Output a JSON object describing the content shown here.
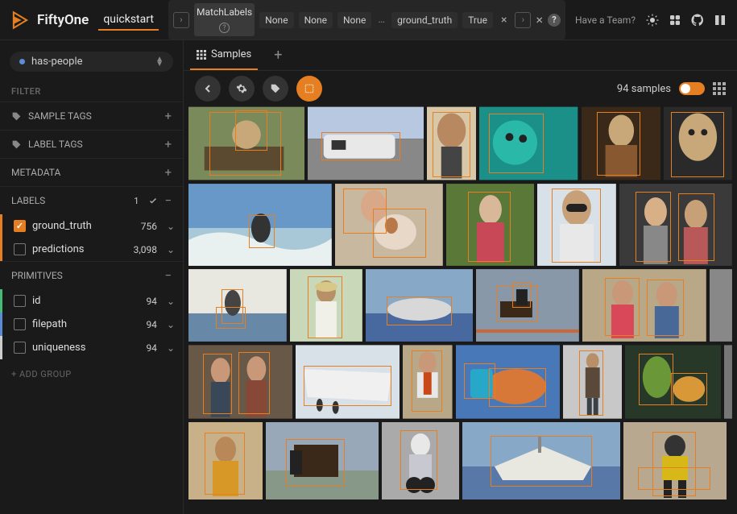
{
  "brand": "FiftyOne",
  "dataset": "quickstart",
  "filterbar": {
    "stage_name": "MatchLabels",
    "pills": [
      "None",
      "None",
      "None"
    ],
    "ellipsis": "…",
    "pill_field": "ground_truth",
    "pill_value": "True"
  },
  "team_link": "Have a Team?",
  "view_selector": "has-people",
  "filter_title": "FILTER",
  "sections": {
    "sample_tags": "SAMPLE TAGS",
    "label_tags": "LABEL TAGS",
    "metadata": "METADATA",
    "labels": "LABELS",
    "labels_badge": "1",
    "primitives": "PRIMITIVES"
  },
  "labels": {
    "ground_truth": {
      "name": "ground_truth",
      "count": "756"
    },
    "predictions": {
      "name": "predictions",
      "count": "3,098"
    }
  },
  "primitives": {
    "id": {
      "name": "id",
      "count": "94"
    },
    "filepath": {
      "name": "filepath",
      "count": "94"
    },
    "uniqueness": {
      "name": "uniqueness",
      "count": "94"
    }
  },
  "add_group": "+ ADD GROUP",
  "tabbar": {
    "samples": "Samples"
  },
  "toolbar": {
    "sample_count": "94 samples"
  }
}
